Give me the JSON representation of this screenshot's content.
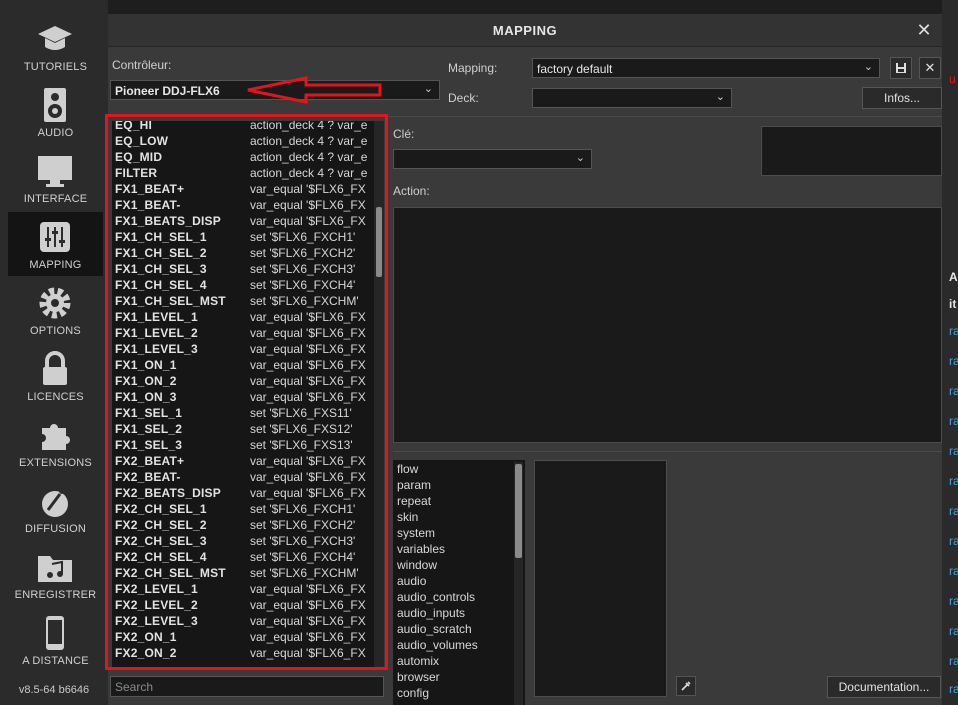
{
  "sidebar": {
    "items": [
      {
        "label": "TUTORIELS",
        "icon": "graduation-cap-icon"
      },
      {
        "label": "AUDIO",
        "icon": "speaker-icon"
      },
      {
        "label": "INTERFACE",
        "icon": "monitor-icon"
      },
      {
        "label": "MAPPING",
        "icon": "sliders-icon",
        "active": true
      },
      {
        "label": "OPTIONS",
        "icon": "gear-icon"
      },
      {
        "label": "LICENCES",
        "icon": "lock-icon"
      },
      {
        "label": "EXTENSIONS",
        "icon": "puzzle-icon"
      },
      {
        "label": "DIFFUSION",
        "icon": "broadcast-icon"
      },
      {
        "label": "ENREGISTRER",
        "icon": "music-folder-icon"
      },
      {
        "label": "A DISTANCE",
        "icon": "phone-icon"
      }
    ],
    "version": "v8.5-64 b6646"
  },
  "dialog": {
    "title": "MAPPING",
    "close": "✕",
    "controller_label": "Contrôleur:",
    "controller_value": "Pioneer DDJ-FLX6",
    "mapping_label": "Mapping:",
    "mapping_value": "factory default",
    "deck_label": "Deck:",
    "deck_value": "",
    "info_button": "Infos...",
    "key_label": "Clé:",
    "key_value": "",
    "action_label": "Action:",
    "search_placeholder": "Search",
    "documentation_button": "Documentation..."
  },
  "key_list": [
    {
      "key": "EQ_HI",
      "action": "action_deck 4 ? var_e"
    },
    {
      "key": "EQ_LOW",
      "action": "action_deck 4 ? var_e"
    },
    {
      "key": "EQ_MID",
      "action": "action_deck 4 ? var_e"
    },
    {
      "key": "FILTER",
      "action": "action_deck 4 ? var_e"
    },
    {
      "key": "FX1_BEAT+",
      "action": "var_equal '$FLX6_FX"
    },
    {
      "key": "FX1_BEAT-",
      "action": "var_equal '$FLX6_FX"
    },
    {
      "key": "FX1_BEATS_DISP",
      "action": "var_equal '$FLX6_FX"
    },
    {
      "key": "FX1_CH_SEL_1",
      "action": "set '$FLX6_FXCH1'"
    },
    {
      "key": "FX1_CH_SEL_2",
      "action": "set '$FLX6_FXCH2'"
    },
    {
      "key": "FX1_CH_SEL_3",
      "action": "set '$FLX6_FXCH3'"
    },
    {
      "key": "FX1_CH_SEL_4",
      "action": "set '$FLX6_FXCH4'"
    },
    {
      "key": "FX1_CH_SEL_MST",
      "action": "set '$FLX6_FXCHM'"
    },
    {
      "key": "FX1_LEVEL_1",
      "action": "var_equal '$FLX6_FX"
    },
    {
      "key": "FX1_LEVEL_2",
      "action": "var_equal '$FLX6_FX"
    },
    {
      "key": "FX1_LEVEL_3",
      "action": "var_equal '$FLX6_FX"
    },
    {
      "key": "FX1_ON_1",
      "action": "var_equal '$FLX6_FX"
    },
    {
      "key": "FX1_ON_2",
      "action": "var_equal '$FLX6_FX"
    },
    {
      "key": "FX1_ON_3",
      "action": "var_equal '$FLX6_FX"
    },
    {
      "key": "FX1_SEL_1",
      "action": "set '$FLX6_FXS11'"
    },
    {
      "key": "FX1_SEL_2",
      "action": "set '$FLX6_FXS12'"
    },
    {
      "key": "FX1_SEL_3",
      "action": "set '$FLX6_FXS13'"
    },
    {
      "key": "FX2_BEAT+",
      "action": "var_equal '$FLX6_FX"
    },
    {
      "key": "FX2_BEAT-",
      "action": "var_equal '$FLX6_FX"
    },
    {
      "key": "FX2_BEATS_DISP",
      "action": "var_equal '$FLX6_FX"
    },
    {
      "key": "FX2_CH_SEL_1",
      "action": "set '$FLX6_FXCH1'"
    },
    {
      "key": "FX2_CH_SEL_2",
      "action": "set '$FLX6_FXCH2'"
    },
    {
      "key": "FX2_CH_SEL_3",
      "action": "set '$FLX6_FXCH3'"
    },
    {
      "key": "FX2_CH_SEL_4",
      "action": "set '$FLX6_FXCH4'"
    },
    {
      "key": "FX2_CH_SEL_MST",
      "action": "set '$FLX6_FXCHM'"
    },
    {
      "key": "FX2_LEVEL_1",
      "action": "var_equal '$FLX6_FX"
    },
    {
      "key": "FX2_LEVEL_2",
      "action": "var_equal '$FLX6_FX"
    },
    {
      "key": "FX2_LEVEL_3",
      "action": "var_equal '$FLX6_FX"
    },
    {
      "key": "FX2_ON_1",
      "action": "var_equal '$FLX6_FX"
    },
    {
      "key": "FX2_ON_2",
      "action": "var_equal '$FLX6_FX"
    }
  ],
  "verb_categories": [
    "flow",
    "param",
    "repeat",
    "skin",
    "system",
    "variables",
    "window",
    "audio",
    "audio_controls",
    "audio_inputs",
    "audio_scratch",
    "audio_volumes",
    "automix",
    "browser",
    "config"
  ],
  "bg_window": {
    "letters": [
      "u",
      "A",
      "it",
      "ra",
      "ra",
      "ra",
      "ra",
      "ra",
      "ra",
      "ra",
      "ra",
      "ra",
      "ra",
      "ra",
      "ra",
      "ra"
    ]
  },
  "colors": {
    "highlight": "#e3141c",
    "link": "#3da7e6"
  }
}
